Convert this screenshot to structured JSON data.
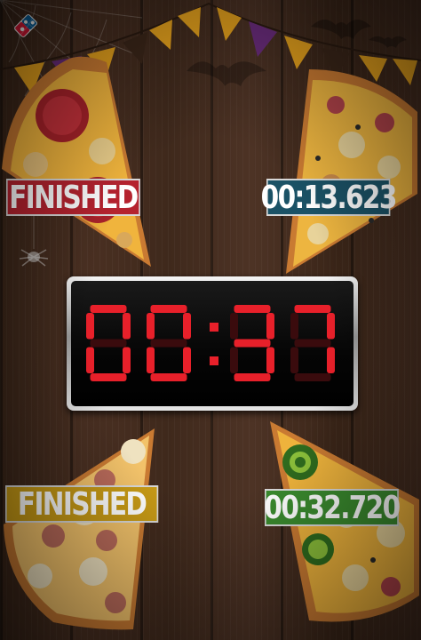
{
  "players": {
    "top_left": {
      "status": "FINISHED",
      "color": "#b5232f"
    },
    "top_right": {
      "status": "00:13.623",
      "color": "#1b5266"
    },
    "bottom_left": {
      "status": "FINISHED",
      "color": "#c79a16"
    },
    "bottom_right": {
      "status": "00:32.720",
      "color": "#3a8a2e"
    }
  },
  "timer": {
    "text": "00:37",
    "segment_color": "#e8202a"
  },
  "logo": {
    "icon": "dominos-logo-icon"
  },
  "decor": {
    "bunting_colors": [
      "#e6a21d",
      "#6c2d7e",
      "#e6a21d",
      "#3b2619"
    ],
    "icons": [
      "spiderweb-icon",
      "bat-icon",
      "spider-icon"
    ]
  }
}
